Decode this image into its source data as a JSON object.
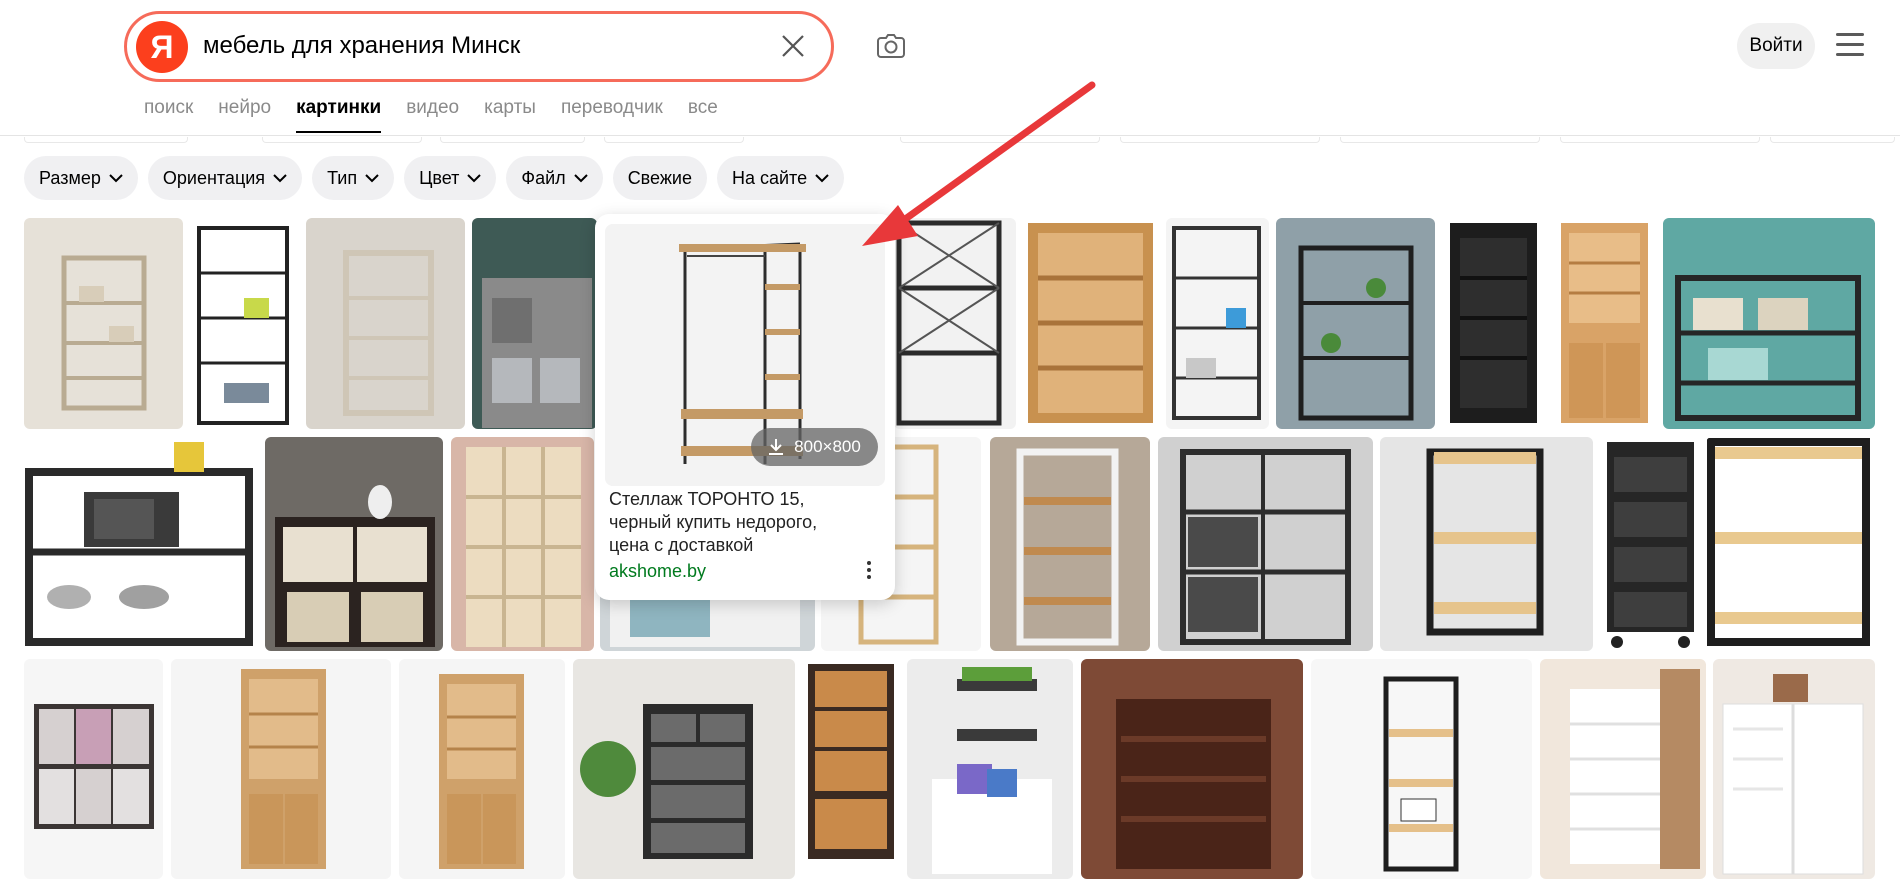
{
  "search": {
    "logo": "Я",
    "query": "мебель для хранения Минск"
  },
  "header": {
    "login_label": "Войти",
    "camera": "camera-icon",
    "menu": "hamburger-menu-icon"
  },
  "tabs": [
    {
      "label": "поиск",
      "active": false
    },
    {
      "label": "нейро",
      "active": false
    },
    {
      "label": "картинки",
      "active": true
    },
    {
      "label": "видео",
      "active": false
    },
    {
      "label": "карты",
      "active": false
    },
    {
      "label": "переводчик",
      "active": false
    },
    {
      "label": "все",
      "active": false
    }
  ],
  "filters": [
    "Размер",
    "Ориентация",
    "Тип",
    "Цвет",
    "Файл",
    "Свежие",
    "На сайте"
  ],
  "popup": {
    "title_lines": [
      "Стеллаж ТОРОНТО 15,",
      "черный купить недорого,",
      "цена с доставкой"
    ],
    "domain": "akshome.by",
    "size": "800×800"
  },
  "colors": {
    "accent": "#fc3f1d",
    "search_border": "#f66b5a",
    "link_green": "#007a1e",
    "arrow": "#e8383a"
  }
}
